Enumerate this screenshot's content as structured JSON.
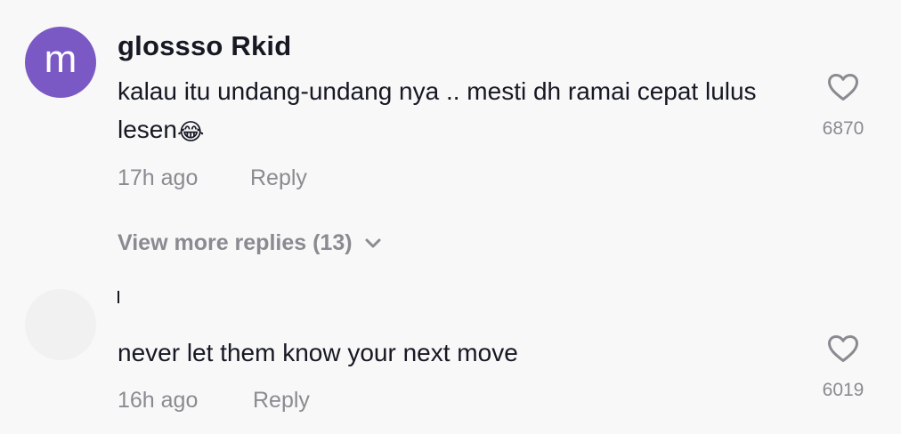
{
  "comments": [
    {
      "avatar_letter": "m",
      "avatar_color": "#7b59c4",
      "username": "glossso Rkid",
      "text": "kalau itu undang-undang nya .. mesti dh ramai cepat lulus lesen",
      "emoji": "😂",
      "time": "17h ago",
      "reply_label": "Reply",
      "like_count": "6870",
      "view_more_label": "View more replies (13)"
    },
    {
      "avatar_color": "#f1f1f1",
      "username": "",
      "text": "never let them know your next move",
      "time": "16h ago",
      "reply_label": "Reply",
      "like_count": "6019"
    }
  ],
  "colors": {
    "background": "#f8f8f8",
    "primary_text": "#161823",
    "secondary_text": "#8a8b91"
  },
  "icons": {
    "like": "heart-outline-icon",
    "expand": "chevron-down-icon"
  }
}
